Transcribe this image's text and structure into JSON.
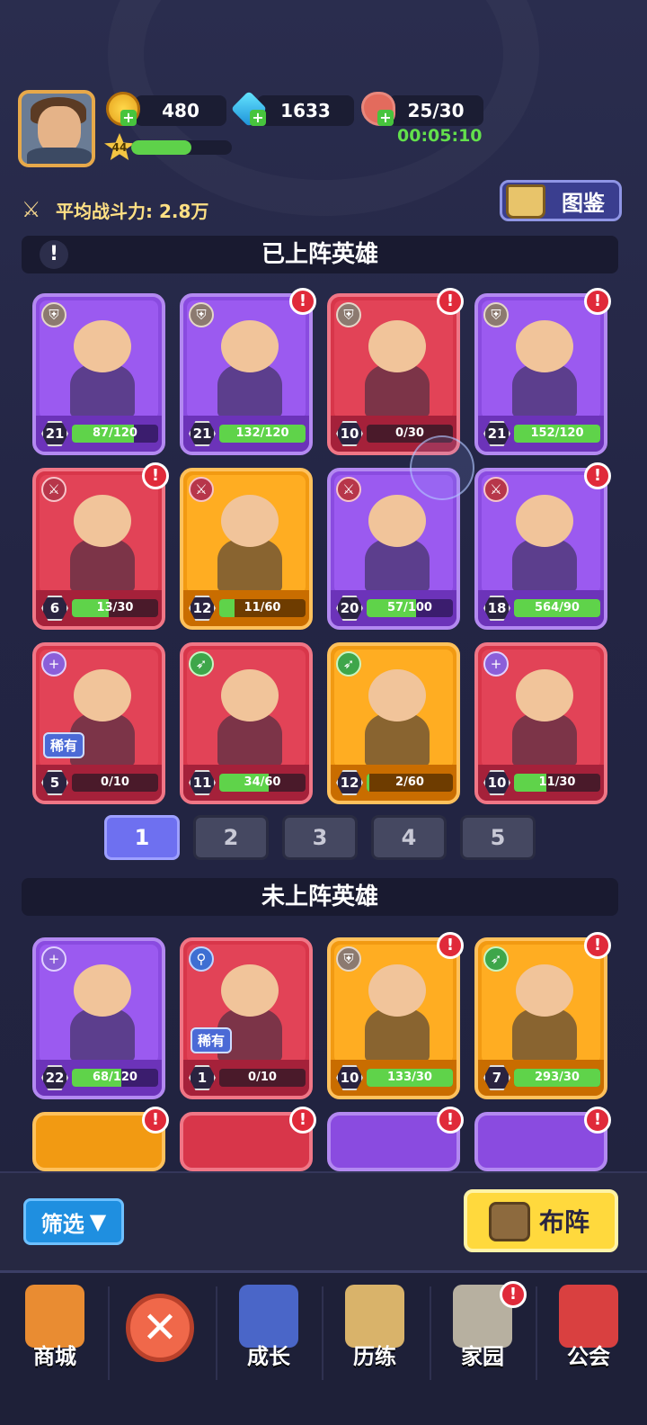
{
  "resources": {
    "gold": "480",
    "gems": "1633",
    "stamina": "25/30",
    "stamina_timer": "00:05:10"
  },
  "player": {
    "level": "44",
    "xp_fraction": 0.6
  },
  "power": {
    "label": "平均战斗力: 2.8万"
  },
  "atlas_button": {
    "label": "图鉴"
  },
  "deployed_section": {
    "title": "已上阵英雄",
    "alert_icon": "!"
  },
  "deployed_heroes": [
    {
      "level": "21",
      "progress": "87/120",
      "fill": 0.72,
      "color": "purple",
      "class_icon": "shield",
      "alert": false
    },
    {
      "level": "21",
      "progress": "132/120",
      "fill": 1.0,
      "color": "purple",
      "class_icon": "shield",
      "alert": true
    },
    {
      "level": "10",
      "progress": "0/30",
      "fill": 0.0,
      "color": "red",
      "class_icon": "shield",
      "alert": true
    },
    {
      "level": "21",
      "progress": "152/120",
      "fill": 1.0,
      "color": "purple",
      "class_icon": "shield",
      "alert": true
    },
    {
      "level": "6",
      "progress": "13/30",
      "fill": 0.43,
      "color": "red",
      "class_icon": "sword",
      "alert": true
    },
    {
      "level": "12",
      "progress": "11/60",
      "fill": 0.18,
      "color": "orange",
      "class_icon": "sword",
      "alert": false
    },
    {
      "level": "20",
      "progress": "57/100",
      "fill": 0.57,
      "color": "purple",
      "class_icon": "sword",
      "alert": false
    },
    {
      "level": "18",
      "progress": "564/90",
      "fill": 1.0,
      "color": "purple",
      "class_icon": "sword",
      "alert": true
    },
    {
      "level": "5",
      "progress": "0/10",
      "fill": 0.0,
      "color": "red",
      "class_icon": "plus",
      "alert": false,
      "rare": "稀有"
    },
    {
      "level": "11",
      "progress": "34/60",
      "fill": 0.57,
      "color": "red",
      "class_icon": "bow",
      "alert": false
    },
    {
      "level": "12",
      "progress": "2/60",
      "fill": 0.03,
      "color": "orange",
      "class_icon": "bow",
      "alert": false
    },
    {
      "level": "10",
      "progress": "11/30",
      "fill": 0.37,
      "color": "red",
      "class_icon": "plus",
      "alert": false
    }
  ],
  "pages": [
    "1",
    "2",
    "3",
    "4",
    "5"
  ],
  "undeployed_section": {
    "title": "未上阵英雄"
  },
  "undeployed_heroes": [
    {
      "level": "22",
      "progress": "68/120",
      "fill": 0.57,
      "color": "purple",
      "class_icon": "plus",
      "alert": false
    },
    {
      "level": "1",
      "progress": "0/10",
      "fill": 0.0,
      "color": "red",
      "class_icon": "magic",
      "alert": false,
      "rare": "稀有"
    },
    {
      "level": "10",
      "progress": "133/30",
      "fill": 1.0,
      "color": "orange",
      "class_icon": "shield",
      "alert": true
    },
    {
      "level": "7",
      "progress": "293/30",
      "fill": 1.0,
      "color": "orange",
      "class_icon": "bow",
      "alert": true
    }
  ],
  "filter_button": {
    "label": "筛选"
  },
  "deploy_button": {
    "label": "布阵"
  },
  "nav": [
    {
      "label": "商城",
      "icon": "shop-icon"
    },
    {
      "label": "",
      "icon": "close-icon"
    },
    {
      "label": "成长",
      "icon": "growth-icon"
    },
    {
      "label": "历练",
      "icon": "map-icon"
    },
    {
      "label": "家园",
      "icon": "home-icon"
    },
    {
      "label": "公会",
      "icon": "guild-icon"
    }
  ],
  "colors": {
    "purple": "#8a4be0",
    "red": "#d8364a",
    "orange": "#f29a12",
    "accent_green": "#5fd34a"
  }
}
